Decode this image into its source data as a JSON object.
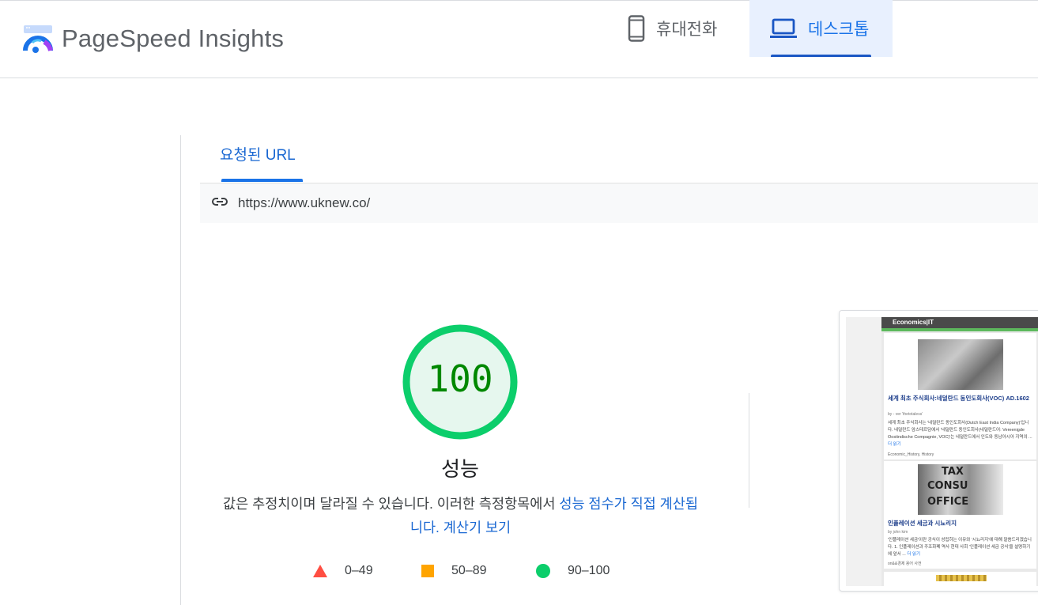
{
  "header": {
    "brand": "PageSpeed Insights"
  },
  "device_tabs": [
    {
      "label": "휴대전화",
      "icon": "smartphone-icon",
      "selected": false
    },
    {
      "label": "데스크톱",
      "icon": "laptop-icon",
      "selected": true
    }
  ],
  "url_section": {
    "tab_label": "요청된 URL",
    "url": "https://www.uknew.co/"
  },
  "score": {
    "value": "100",
    "title": "성능",
    "desc_plain": "값은 추정치이며 달라질 수 있습니다. 이러한 측정항목에서 ",
    "desc_link1": "성능 점수가 직접 계산됩니다.",
    "desc_link2": "계산기 보기",
    "color": "#0cce6b",
    "number_color": "#008800"
  },
  "legend": [
    {
      "range": "0–49",
      "shape": "triangle",
      "color": "#ff4e42"
    },
    {
      "range": "50–89",
      "shape": "square",
      "color": "#ffa400"
    },
    {
      "range": "90–100",
      "shape": "circle",
      "color": "#0cce6b"
    }
  ],
  "screenshot": {
    "header": "Economics|IT",
    "post1": {
      "title": "세계 최초 주식회사:네덜란드 동인도회사(VOC) AD.1602",
      "meta": "by - ver 'thetotaless'",
      "body": "세계 최초 주식회사는 '네덜란드 동인도회사(Dutch East India Company)'입니다. 네덜란드 암스테르담에서 '네덜란드 동인도회사(네덜란드어: Vereenigde Oostindische Compagnie, VOC)'는 네덜란드에서 인도와 동남아시아 지역의 ...",
      "more": "더 읽기",
      "tags": "Economic_History, History"
    },
    "post2": {
      "title": "인플레이션 세금과 시뇨리지",
      "meta": "by john kim",
      "body": "'인플레이션 세금'이란 공식이 성립하는 이유와 '시뇨리지'에 대해 말씀드리겠습니다. 1. 인플레이션과 주조화폐 역사 현대 사회 '인플레이션 세금 공식'을 설명하기에 앞서 ...",
      "more": "더 읽기",
      "tags": "on&&경제 용어 사전",
      "img_lines": [
        "TAX",
        "CONSU",
        "OFFICE"
      ]
    }
  }
}
